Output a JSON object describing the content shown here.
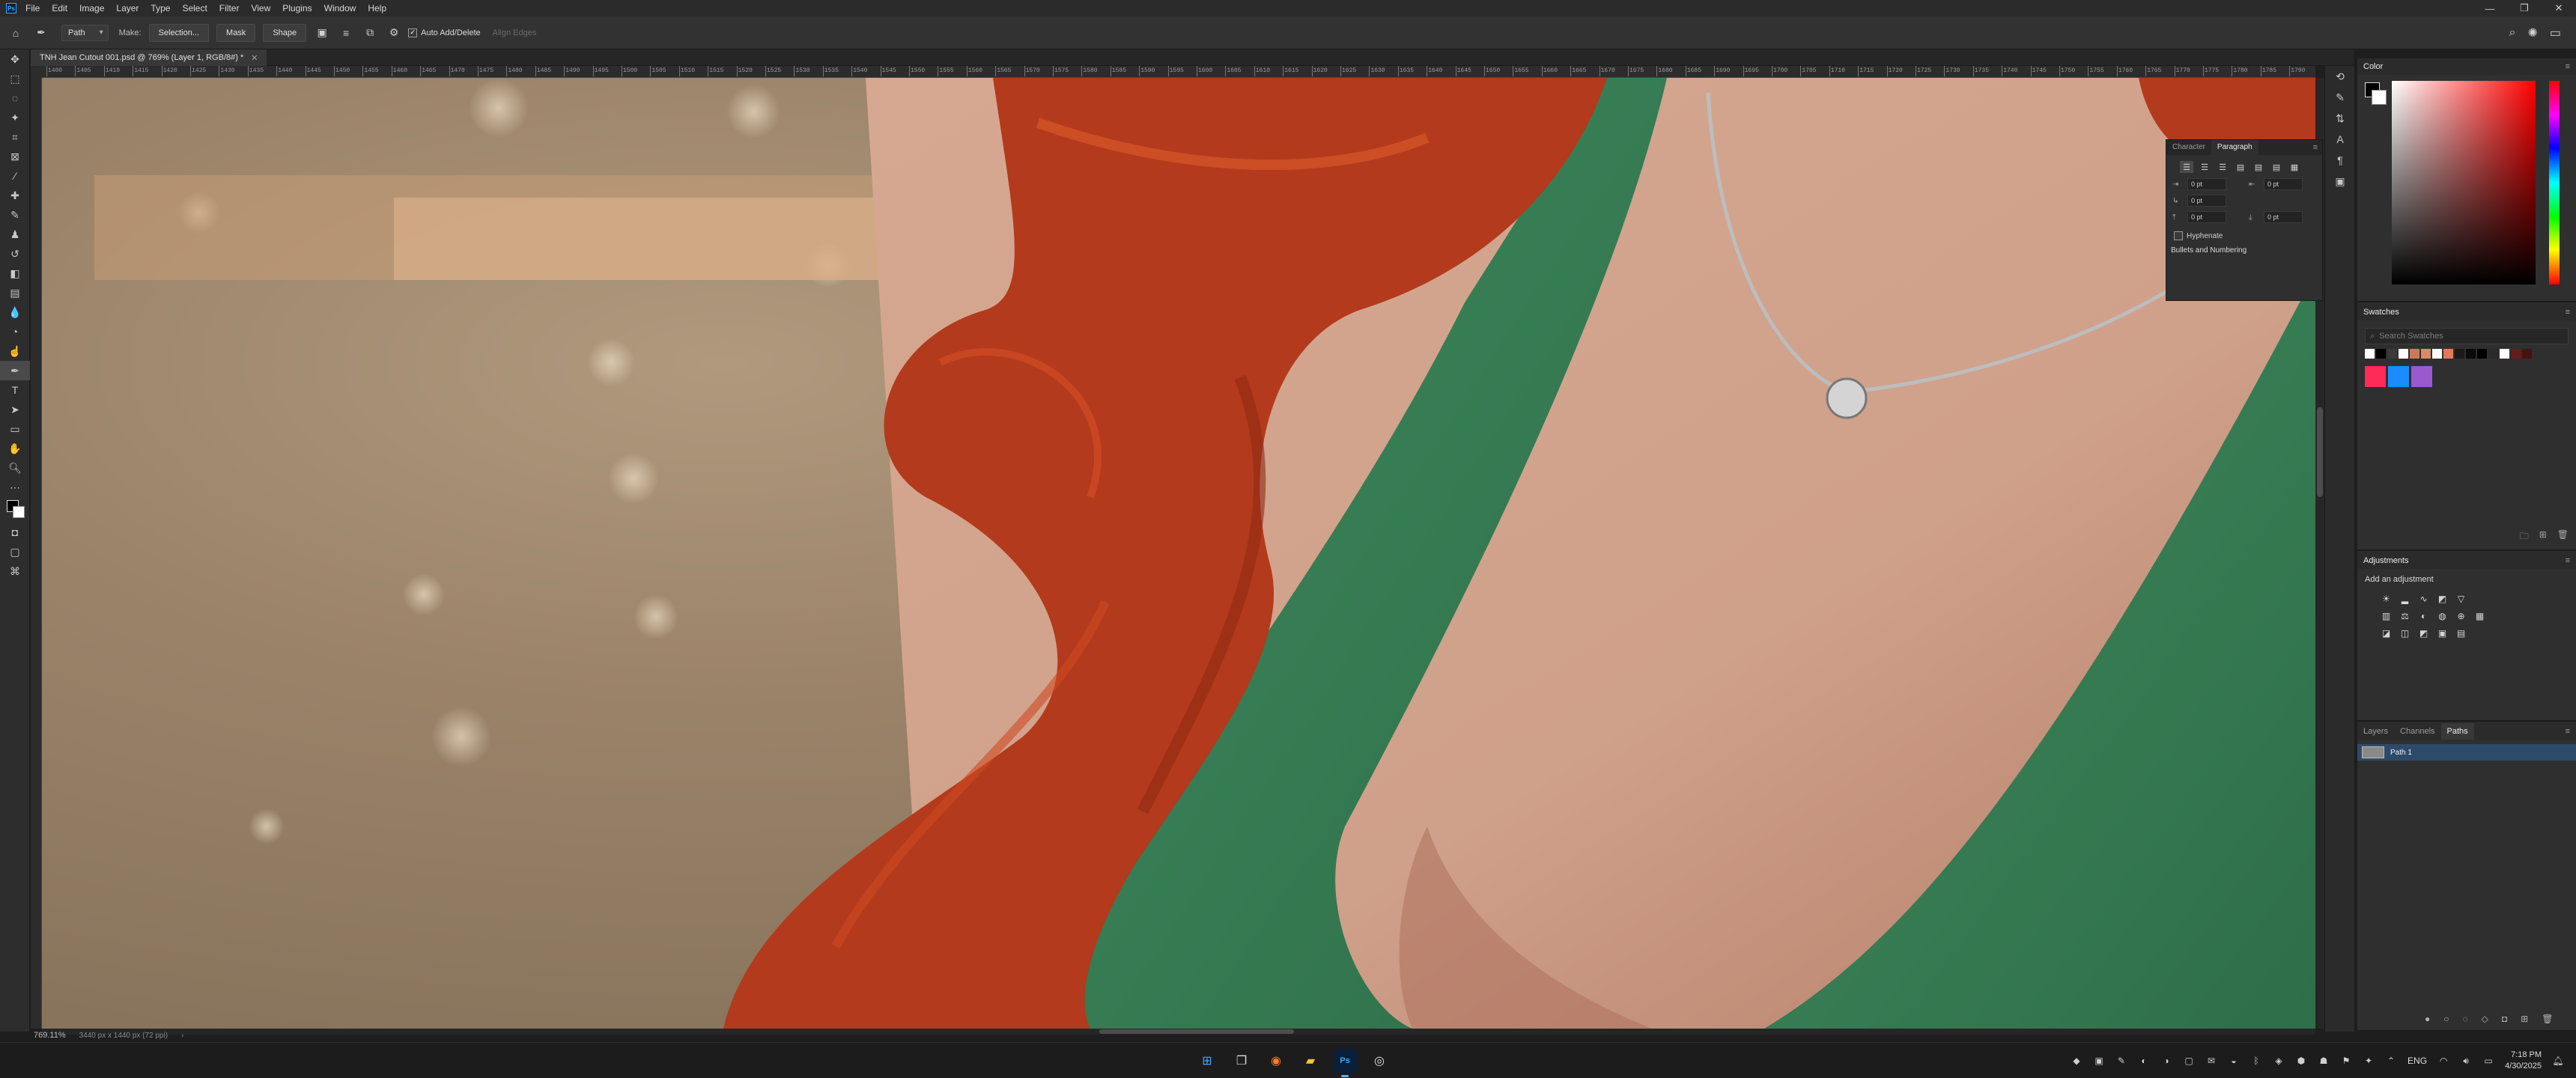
{
  "menubar": {
    "logo": "Ps",
    "items": [
      "File",
      "Edit",
      "Image",
      "Layer",
      "Type",
      "Select",
      "Filter",
      "View",
      "Plugins",
      "Window",
      "Help"
    ],
    "window_controls": [
      "—",
      "❐",
      "✕"
    ]
  },
  "options": {
    "mode": "Path",
    "make_label": "Make:",
    "selection_btn": "Selection...",
    "mask_btn": "Mask",
    "shape_btn": "Shape",
    "auto_add_delete": "Auto Add/Delete",
    "auto_add_delete_checked": true,
    "align_edges": "Align Edges"
  },
  "document": {
    "tab_title": "TNH Jean Cutout 001.psd @ 769% (Layer 1, RGB/8#) *",
    "zoom": "769.11%",
    "doc_size": "3440 px x 1440 px (72 ppi)"
  },
  "ruler_ticks": [
    "1400",
    "1405",
    "1410",
    "1415",
    "1420",
    "1425",
    "1430",
    "1435",
    "1440",
    "1445",
    "1450",
    "1455",
    "1460",
    "1465",
    "1470",
    "1475",
    "1480",
    "1485",
    "1490",
    "1495",
    "1500",
    "1505",
    "1510",
    "1515",
    "1520",
    "1525",
    "1530",
    "1535",
    "1540",
    "1545",
    "1550",
    "1555",
    "1560",
    "1565",
    "1570",
    "1575",
    "1580",
    "1585",
    "1590",
    "1595",
    "1600",
    "1605",
    "1610",
    "1615",
    "1620",
    "1625",
    "1630",
    "1635",
    "1640",
    "1645",
    "1650",
    "1655",
    "1660",
    "1665",
    "1670",
    "1675",
    "1680",
    "1685",
    "1690",
    "1695",
    "1700",
    "1705",
    "1710",
    "1715",
    "1720",
    "1725",
    "1730",
    "1735",
    "1740",
    "1745",
    "1750",
    "1755",
    "1760",
    "1765",
    "1770",
    "1775",
    "1780",
    "1785",
    "1790"
  ],
  "paragraph_panel": {
    "tabs": [
      "Character",
      "Paragraph"
    ],
    "active_tab": "Paragraph",
    "fields": {
      "indent_left": "0 pt",
      "indent_right": "0 pt",
      "indent_first": "0 pt",
      "space_before": "0 pt",
      "space_after": "0 pt"
    },
    "hyphenate": "Hyphenate",
    "bullets": "Bullets and Numbering"
  },
  "panels": {
    "color_title": "Color",
    "swatches_title": "Swatches",
    "swatches_search_placeholder": "Search Swatches",
    "swatches_row1": [
      "#ffffff",
      "#000000",
      "#3a3a3a",
      "#ffffff",
      "#c97a5a",
      "#d98a6a",
      "#ffffff",
      "#e07a5a",
      "#1a1a1a",
      "#0a0a0a",
      "#000000",
      "#2a2a2a",
      "#ffffff",
      "#6a1a1a",
      "#4a1010"
    ],
    "swatches_row2": [
      "#ff2a55",
      "#1a8cff",
      "#9b59d0"
    ],
    "adjustments_title": "Adjustments",
    "adjustments_sub": "Add an adjustment",
    "layer_tabs": [
      "Layers",
      "Channels",
      "Paths"
    ],
    "active_layer_tab": "Paths",
    "path_name": "Path 1"
  },
  "taskbar": {
    "time": "7:18 PM",
    "date": "4/30/2025",
    "lang": "ENG"
  },
  "colors": {
    "accent": "#31a8ff",
    "selection": "#2e4a6b"
  }
}
